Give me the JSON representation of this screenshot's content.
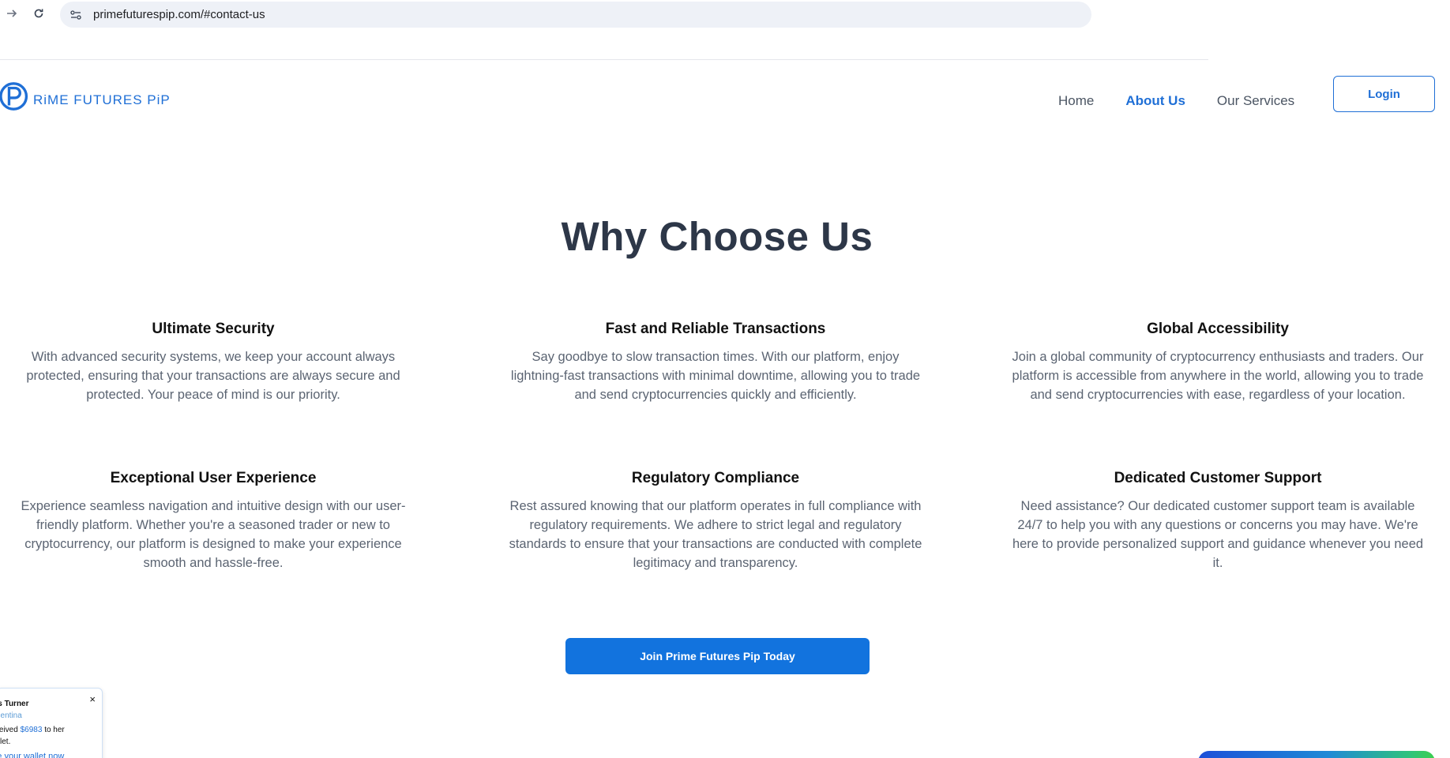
{
  "browser": {
    "url": "primefuturespip.com/#contact-us"
  },
  "header": {
    "logo_text": "RiME FUTURES PiP",
    "nav": [
      {
        "label": "Home",
        "active": false
      },
      {
        "label": "About Us",
        "active": true
      },
      {
        "label": "Our Services",
        "active": false
      }
    ],
    "login_label": "Login"
  },
  "section": {
    "title": "Why Choose Us",
    "features": [
      {
        "title": "Ultimate Security",
        "text": "With advanced security systems, we keep your account always protected, ensuring that your transactions are always secure and protected. Your peace of mind is our priority."
      },
      {
        "title": "Fast and Reliable Transactions",
        "text": "Say goodbye to slow transaction times. With our platform, enjoy lightning-fast transactions with minimal downtime, allowing you to trade and send cryptocurrencies quickly and efficiently."
      },
      {
        "title": "Global Accessibility",
        "text": "Join a global community of cryptocurrency enthusiasts and traders. Our platform is accessible from anywhere in the world, allowing you to trade and send cryptocurrencies with ease, regardless of your location."
      },
      {
        "title": "Exceptional User Experience",
        "text": "Experience seamless navigation and intuitive design with our user-friendly platform. Whether you're a seasoned trader or new to cryptocurrency, our platform is designed to make your experience smooth and hassle-free."
      },
      {
        "title": "Regulatory Compliance",
        "text": "Rest assured knowing that our platform operates in full compliance with regulatory requirements. We adhere to strict legal and regulatory standards to ensure that your transactions are conducted with complete legitimacy and transparency."
      },
      {
        "title": "Dedicated Customer Support",
        "text": "Need assistance? Our dedicated customer support team is available 24/7 to help you with any questions or concerns you may have. We're here to provide personalized support and guidance whenever you need it."
      }
    ],
    "cta_label": "Join Prime Futures Pip Today"
  },
  "popup": {
    "name": "rles Turner",
    "country": "Argentina",
    "msg_prefix": "received",
    "amount": "$6983",
    "msg_suffix": "to her wallet.",
    "link": "eate your wallet now",
    "close": "×"
  },
  "colors": {
    "brand_blue": "#1f6fd6",
    "cta_blue": "#1273de",
    "heading": "#2d3748"
  }
}
